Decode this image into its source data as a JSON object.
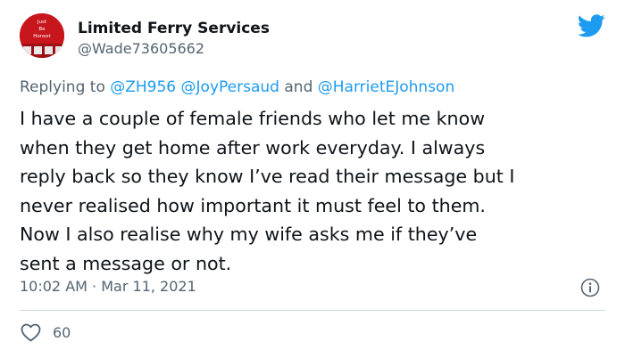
{
  "author": {
    "display_name": "Limited Ferry Services",
    "handle": "@Wade73605662",
    "avatar_text": [
      "Just",
      "Be",
      "Honest"
    ]
  },
  "reply": {
    "prefix": "Replying to",
    "mention_1": "@ZH956",
    "mention_2": "@JoyPersaud",
    "conjunction": "and",
    "mention_3": "@HarrietEJohnson"
  },
  "tweet": {
    "lines": [
      "I have a couple of female friends who let me know",
      "when they get home after work everyday. I always",
      "reply back so they know I’ve read their message but I",
      "never realised how important it must feel to them.",
      "Now I also realise why my wife asks me if they’ve",
      "sent a message or not."
    ],
    "time": "10:02 AM",
    "separator": "·",
    "date": "Mar 11, 2021"
  },
  "actions": {
    "like_count": "60"
  },
  "colors": {
    "twitter_blue": "#1d9bf0",
    "secondary_text": "#536471",
    "avatar_red": "#c8161d"
  },
  "icons": {
    "brand": "twitter-bird-icon",
    "info": "info-icon",
    "like": "heart-icon"
  }
}
